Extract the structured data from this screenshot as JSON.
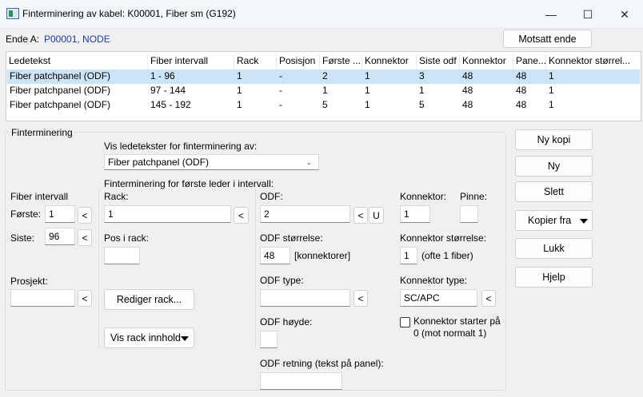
{
  "window": {
    "title": "Finterminering av kabel: K00001, Fiber sm (G192)",
    "minimize_glyph": "—",
    "maximize_glyph": "☐",
    "close_glyph": "✕"
  },
  "header": {
    "ende_label": "Ende A:",
    "ende_value": "P00001, NODE",
    "motsatt_button": "Motsatt ende"
  },
  "table": {
    "columns": [
      "Ledetekst",
      "Fiber intervall",
      "Rack",
      "Posisjon",
      "Første ...",
      "Konnektor",
      "Siste odf",
      "Konnektor",
      "Pane...",
      "Konnektor størrel..."
    ],
    "rows": [
      [
        "Fiber patchpanel (ODF)",
        "1 - 96",
        "1",
        "-",
        "2",
        "1",
        "3",
        "48",
        "48",
        "1"
      ],
      [
        "Fiber patchpanel (ODF)",
        "97 - 144",
        "1",
        "-",
        "1",
        "1",
        "1",
        "48",
        "48",
        "1"
      ],
      [
        "Fiber patchpanel (ODF)",
        "145 - 192",
        "1",
        "-",
        "5",
        "1",
        "5",
        "48",
        "48",
        "1"
      ]
    ]
  },
  "group": {
    "title": "Finterminering",
    "vis_label": "Vis ledetekster for finterminering av:",
    "vis_value": "Fiber patchpanel (ODF)",
    "first_leder_label": "Finterminering for første leder i intervall:",
    "fiber_intervall_label": "Fiber intervall",
    "forste_label": "Første:",
    "forste_value": "1",
    "siste_label": "Siste:",
    "siste_value": "96",
    "prosjekt_label": "Prosjekt:",
    "prosjekt_value": "",
    "rack_label": "Rack:",
    "rack_value": "1",
    "pos_label": "Pos i rack:",
    "pos_value": "",
    "rediger_button": "Rediger rack...",
    "vis_rack_button": "Vis rack innhold",
    "odf_label": "ODF:",
    "odf_value": "2",
    "odf_storrelse_label": "ODF størrelse:",
    "odf_storrelse_value": "48",
    "konnektorer_label": "[konnektorer]",
    "odf_type_label": "ODF type:",
    "odf_type_value": "",
    "odf_hoyde_label": "ODF høyde:",
    "odf_hoyde_value": "",
    "odf_retning_label": "ODF retning (tekst på panel):",
    "odf_retning_value": "",
    "konnektor_label": "Konnektor:",
    "konnektor_value": "1",
    "pinne_label": "Pinne:",
    "pinne_value": "",
    "konnektor_storrelse_label": "Konnektor størrelse:",
    "konnektor_storrelse_value": "1",
    "ofte_label": "(ofte 1 fiber)",
    "konnektor_type_label": "Konnektor type:",
    "konnektor_type_value": "SC/APC",
    "starter_label": "Konnektor starter på 0 (mot normalt 1)",
    "lt_glyph": "<",
    "u_glyph": "U",
    "combo_glyph": "⌄"
  },
  "side_buttons": {
    "ny_kopi": "Ny kopi",
    "ny": "Ny",
    "slett": "Slett",
    "kopier_fra": "Kopier fra",
    "lukk": "Lukk",
    "hjelp": "Hjelp"
  }
}
